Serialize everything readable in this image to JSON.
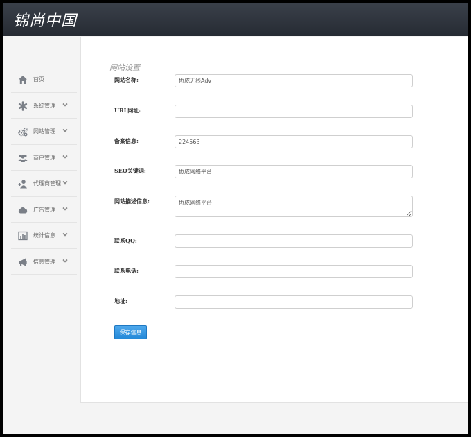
{
  "header": {
    "brand": "锦尚中国"
  },
  "sidebar": {
    "items": [
      {
        "label": "首页",
        "icon": "home-icon"
      },
      {
        "label": "系统管理",
        "icon": "asterisk-icon"
      },
      {
        "label": "网站管理",
        "icon": "gears-icon"
      },
      {
        "label": "商户管理",
        "icon": "users-icon"
      },
      {
        "label": "代理商管理",
        "icon": "user-plus-icon"
      },
      {
        "label": "广告管理",
        "icon": "cloud-icon"
      },
      {
        "label": "统计信息",
        "icon": "bar-chart-icon"
      },
      {
        "label": "信息管理",
        "icon": "megaphone-icon"
      }
    ]
  },
  "form": {
    "title": "网站设置",
    "site_name": {
      "label": "网站名称:",
      "value": "协成无线Adv"
    },
    "url": {
      "label": "URL网址:",
      "value": ""
    },
    "icp": {
      "label": "备案信息:",
      "value": "224563"
    },
    "seo": {
      "label": "SEO关键词:",
      "value": "协成网络平台"
    },
    "description": {
      "label": "网站描述信息:",
      "value": "协成网络平台"
    },
    "qq": {
      "label": "联系QQ:",
      "value": ""
    },
    "phone": {
      "label": "联系电话:",
      "value": ""
    },
    "address": {
      "label": "地址:",
      "value": ""
    },
    "save_label": "保存信息"
  },
  "colors": {
    "header": "#2f353e",
    "accent": "#2f8fde",
    "icon": "#7a7f87"
  }
}
